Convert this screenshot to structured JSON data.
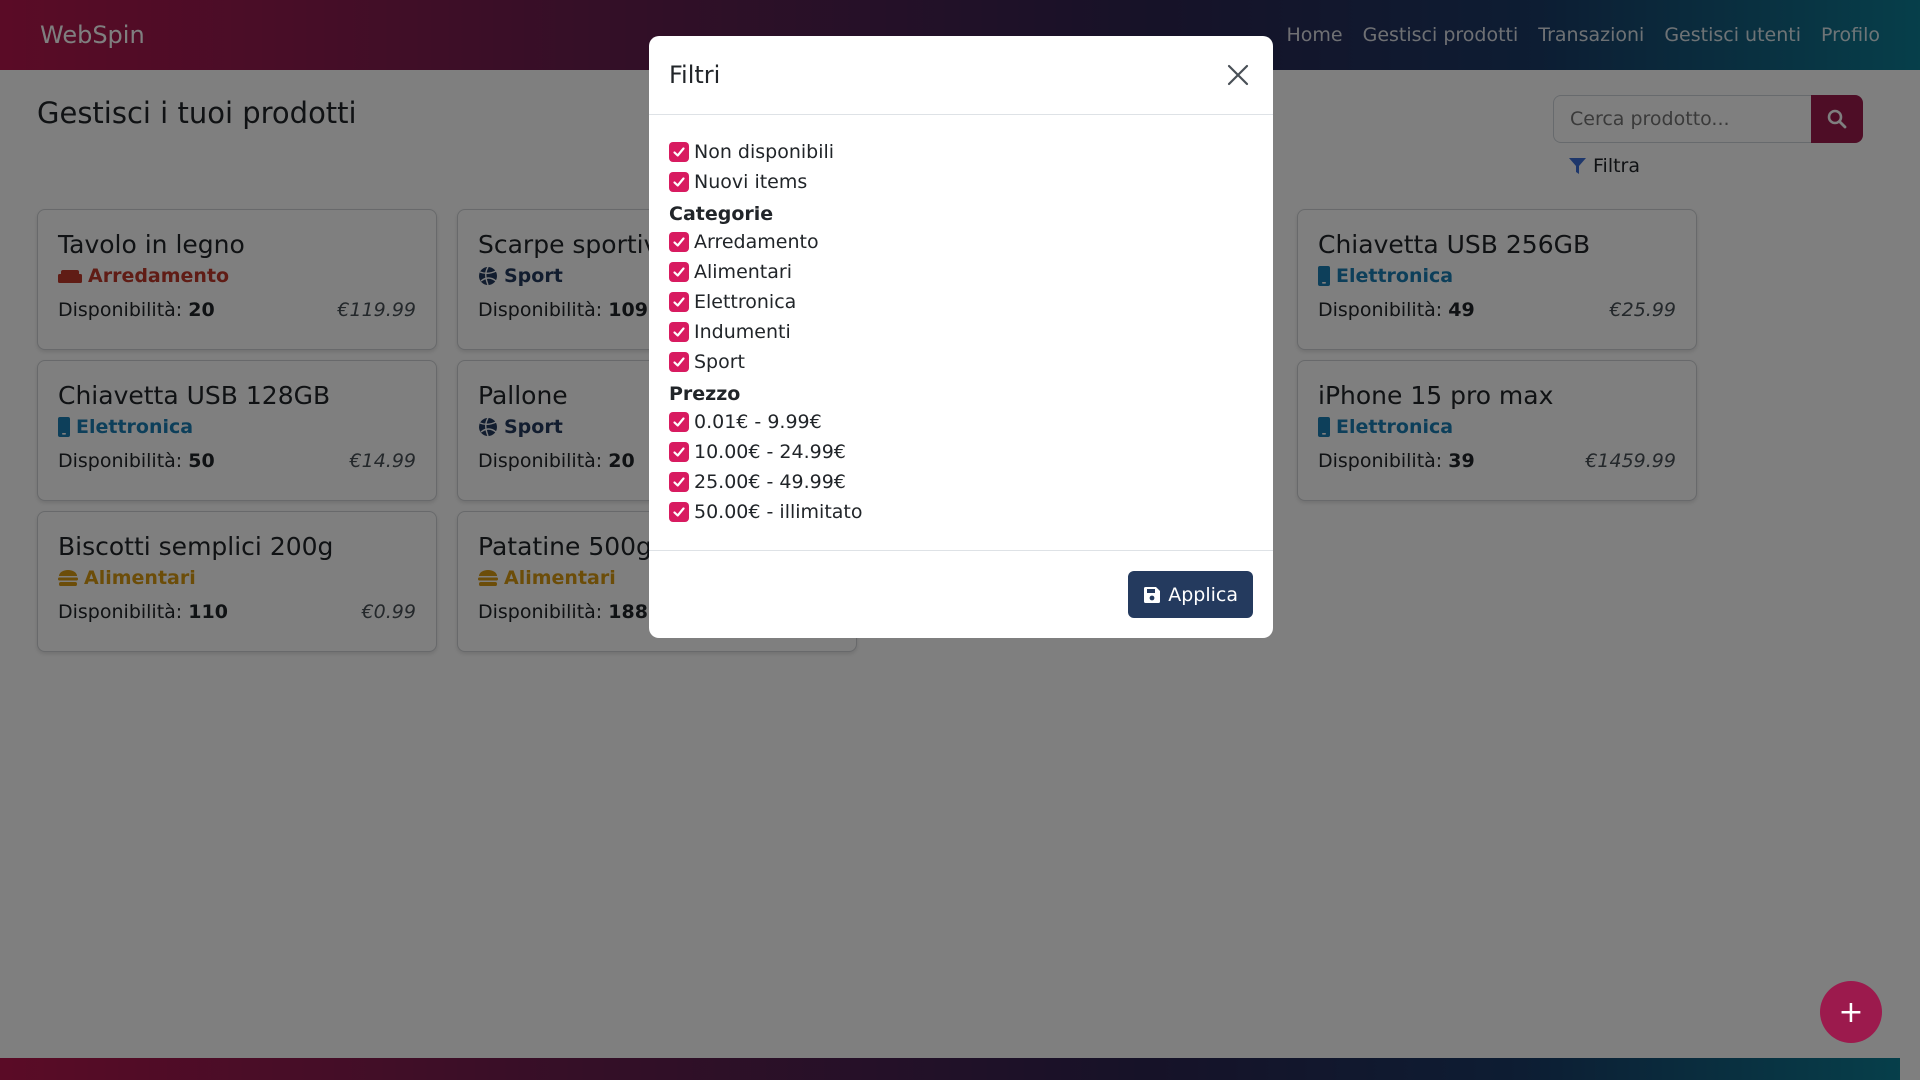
{
  "navbar": {
    "brand": "WebSpin",
    "links": [
      "Home",
      "Gestisci prodotti",
      "Transazioni",
      "Gestisci utenti",
      "Profilo"
    ]
  },
  "page": {
    "title": "Gestisci i tuoi prodotti",
    "search_placeholder": "Cerca prodotto...",
    "filter_label": "Filtra",
    "availability_label": "Disponibilità:"
  },
  "colors": {
    "accent": "#9c1a4d",
    "checkbox": "#d81b60",
    "apply_button": "#243a5e",
    "cat_arredamento": "#c0392b",
    "cat_elettronica": "#1a7fb5",
    "cat_alimentari": "#d89a12",
    "cat_sport": "#243a5e"
  },
  "products": [
    {
      "name": "Tavolo in legno",
      "category": "Arredamento",
      "icon": "couch-icon",
      "qty": "20",
      "price": "€119.99"
    },
    {
      "name": "Scarpe sportive",
      "category": "Sport",
      "icon": "volleyball-icon",
      "qty": "109",
      "price": ""
    },
    {
      "name": "",
      "category": "",
      "icon": "",
      "qty": "",
      "price": ""
    },
    {
      "name": "Chiavetta USB 256GB",
      "category": "Elettronica",
      "icon": "mobile-icon",
      "qty": "49",
      "price": "€25.99"
    },
    {
      "name": "Chiavetta USB 128GB",
      "category": "Elettronica",
      "icon": "mobile-icon",
      "qty": "50",
      "price": "€14.99"
    },
    {
      "name": "Pallone",
      "category": "Sport",
      "icon": "volleyball-icon",
      "qty": "20",
      "price": ""
    },
    {
      "name": "",
      "category": "",
      "icon": "",
      "qty": "",
      "price": ""
    },
    {
      "name": "iPhone 15 pro max",
      "category": "Elettronica",
      "icon": "mobile-icon",
      "qty": "39",
      "price": "€1459.99"
    },
    {
      "name": "Biscotti semplici 200g",
      "category": "Alimentari",
      "icon": "burger-icon",
      "qty": "110",
      "price": "€0.99"
    },
    {
      "name": "Patatine 500g",
      "category": "Alimentari",
      "icon": "burger-icon",
      "qty": "188",
      "price": ""
    },
    {
      "name": "",
      "category": "",
      "icon": "",
      "qty": "",
      "price": ""
    }
  ],
  "modal": {
    "title": "Filtri",
    "general": [
      "Non disponibili",
      "Nuovi items"
    ],
    "categories_label": "Categorie",
    "categories": [
      "Arredamento",
      "Alimentari",
      "Elettronica",
      "Indumenti",
      "Sport"
    ],
    "price_label": "Prezzo",
    "prices": [
      "0.01€ - 9.99€",
      "10.00€ - 24.99€",
      "25.00€ - 49.99€",
      "50.00€ - illimitato"
    ],
    "apply_label": "Applica"
  },
  "fab_label": "+"
}
